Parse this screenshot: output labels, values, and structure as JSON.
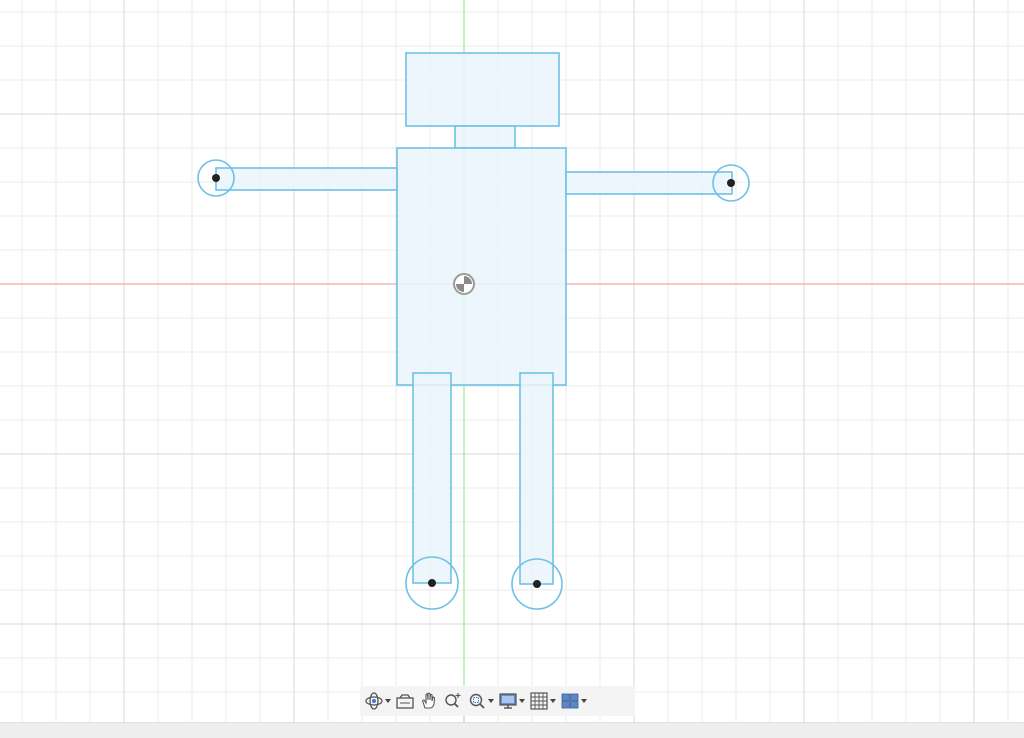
{
  "viewport": {
    "name": "sketch-canvas",
    "axis_colors": {
      "horizontal": "#f4a7a7",
      "vertical": "#a6e3a1"
    },
    "grid_colors": {
      "minor": "#ebebeb",
      "major": "#d9d9d9"
    },
    "sketch_colors": {
      "stroke": "#6ec1e4",
      "fill": "#eaf5fb",
      "point": "#222222"
    }
  },
  "navigation_toolbar": {
    "items": [
      {
        "id": "orbit",
        "icon": "orbit-icon",
        "dropdown": true
      },
      {
        "id": "look-at",
        "icon": "look-at-icon",
        "dropdown": false
      },
      {
        "id": "pan",
        "icon": "pan-hand-icon",
        "dropdown": false
      },
      {
        "id": "zoom",
        "icon": "zoom-icon",
        "dropdown": false
      },
      {
        "id": "fit",
        "icon": "fit-zoom-icon",
        "dropdown": true
      },
      {
        "id": "display-settings",
        "icon": "display-settings-icon",
        "dropdown": true
      },
      {
        "id": "grid-snaps",
        "icon": "grid-icon",
        "dropdown": true
      },
      {
        "id": "viewports",
        "icon": "viewports-icon",
        "dropdown": true
      }
    ]
  }
}
